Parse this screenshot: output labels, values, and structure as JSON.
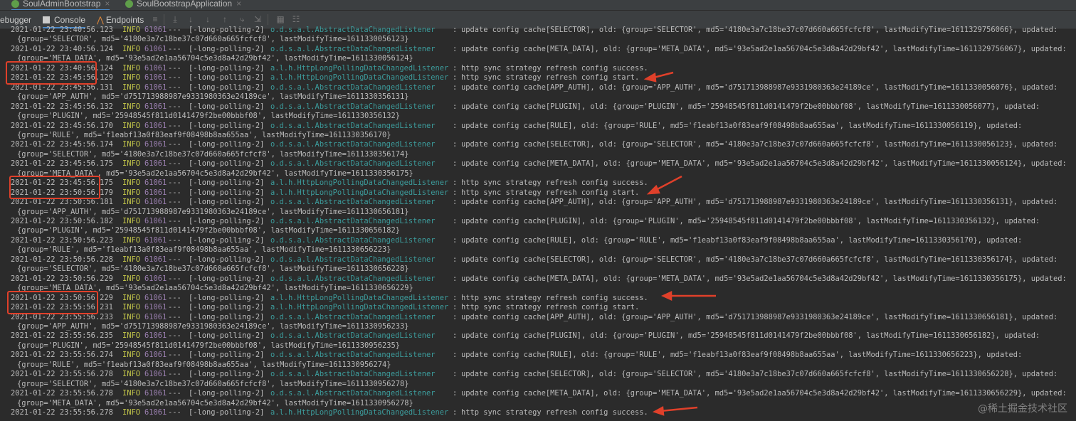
{
  "tabs": [
    {
      "label": "SoulAdminBootstrap",
      "active": true
    },
    {
      "label": "SoulBootstrapApplication",
      "active": false
    }
  ],
  "toolbar": {
    "debugger": "ebugger",
    "console": "Console",
    "endpoints": "Endpoints"
  },
  "watermark": "@稀土掘金技术社区",
  "colors": {
    "background": "#2b2b2b",
    "info": "#c5c84a",
    "pid": "#9b7fb0",
    "logger": "#3c9c9c",
    "highlight": "#e0402a"
  },
  "log": [
    {
      "time": "2021-01-22 23:40:56.123",
      "level": "INFO",
      "pid": "61061",
      "dash": "---",
      "thread": "[-long-polling-2]",
      "logger": "o.d.s.a.l.AbstractDataChangedListener",
      "msg": "update config cache[SELECTOR], old: {group='SELECTOR', md5='4180e3a7c18be37c07d660a665fcfcf8', lastModifyTime=1611329756066}, updated:"
    },
    {
      "cont": "{group='SELECTOR', md5='4180e3a7c18be37c07d660a665fcfcf8', lastModifyTime=1611330056123}"
    },
    {
      "time": "2021-01-22 23:40:56.124",
      "level": "INFO",
      "pid": "61061",
      "dash": "---",
      "thread": "[-long-polling-2]",
      "logger": "o.d.s.a.l.AbstractDataChangedListener",
      "msg": "update config cache[META_DATA], old: {group='META_DATA', md5='93e5ad2e1aa56704c5e3d8a42d29bf42', lastModifyTime=1611329756067}, updated:"
    },
    {
      "cont": "{group='META_DATA', md5='93e5ad2e1aa56704c5e3d8a42d29bf42', lastModifyTime=1611330056124}"
    },
    {
      "time": "2021-01-22 23:40:56.124",
      "level": "INFO",
      "pid": "61061",
      "dash": "---",
      "thread": "[-long-polling-2]",
      "logger": "a.l.h.HttpLongPollingDataChangedListener",
      "msg": "http sync strategy refresh config success."
    },
    {
      "time": "2021-01-22 23:45:56.129",
      "level": "INFO",
      "pid": "61061",
      "dash": "---",
      "thread": "[-long-polling-2]",
      "logger": "a.l.h.HttpLongPollingDataChangedListener",
      "msg": "http sync strategy refresh config start."
    },
    {
      "time": "2021-01-22 23:45:56.131",
      "level": "INFO",
      "pid": "61061",
      "dash": "---",
      "thread": "[-long-polling-2]",
      "logger": "o.d.s.a.l.AbstractDataChangedListener",
      "msg": "update config cache[APP_AUTH], old: {group='APP_AUTH', md5='d751713988987e9331980363e24189ce', lastModifyTime=1611330056076}, updated:"
    },
    {
      "cont": "{group='APP_AUTH', md5='d751713988987e9331980363e24189ce', lastModifyTime=1611330356131}"
    },
    {
      "time": "2021-01-22 23:45:56.132",
      "level": "INFO",
      "pid": "61061",
      "dash": "---",
      "thread": "[-long-polling-2]",
      "logger": "o.d.s.a.l.AbstractDataChangedListener",
      "msg": "update config cache[PLUGIN], old: {group='PLUGIN', md5='25948545f811d0141479f2be00bbbf08', lastModifyTime=1611330056077}, updated:"
    },
    {
      "cont": "{group='PLUGIN', md5='25948545f811d0141479f2be00bbbf08', lastModifyTime=1611330356132}"
    },
    {
      "time": "2021-01-22 23:45:56.170",
      "level": "INFO",
      "pid": "61061",
      "dash": "---",
      "thread": "[-long-polling-2]",
      "logger": "o.d.s.a.l.AbstractDataChangedListener",
      "msg": "update config cache[RULE], old: {group='RULE', md5='f1eabf13a0f83eaf9f08498b8aa655aa', lastModifyTime=1611330056119}, updated:"
    },
    {
      "cont": "{group='RULE', md5='f1eabf13a0f83eaf9f08498b8aa655aa', lastModifyTime=1611330356170}"
    },
    {
      "time": "2021-01-22 23:45:56.174",
      "level": "INFO",
      "pid": "61061",
      "dash": "---",
      "thread": "[-long-polling-2]",
      "logger": "o.d.s.a.l.AbstractDataChangedListener",
      "msg": "update config cache[SELECTOR], old: {group='SELECTOR', md5='4180e3a7c18be37c07d660a665fcfcf8', lastModifyTime=1611330056123}, updated:"
    },
    {
      "cont": "{group='SELECTOR', md5='4180e3a7c18be37c07d660a665fcfcf8', lastModifyTime=1611330356174}"
    },
    {
      "time": "2021-01-22 23:45:56.175",
      "level": "INFO",
      "pid": "61061",
      "dash": "---",
      "thread": "[-long-polling-2]",
      "logger": "o.d.s.a.l.AbstractDataChangedListener",
      "msg": "update config cache[META_DATA], old: {group='META_DATA', md5='93e5ad2e1aa56704c5e3d8a42d29bf42', lastModifyTime=1611330056124}, updated:"
    },
    {
      "cont": "{group='META_DATA', md5='93e5ad2e1aa56704c5e3d8a42d29bf42', lastModifyTime=1611330356175}"
    },
    {
      "time": "2021-01-22 23:45:56.175",
      "level": "INFO",
      "pid": "61061",
      "dash": "---",
      "thread": "[-long-polling-2]",
      "logger": "a.l.h.HttpLongPollingDataChangedListener",
      "msg": "http sync strategy refresh config success."
    },
    {
      "time": "2021-01-22 23:50:56.179",
      "level": "INFO",
      "pid": "61061",
      "dash": "---",
      "thread": "[-long-polling-2]",
      "logger": "a.l.h.HttpLongPollingDataChangedListener",
      "msg": "http sync strategy refresh config start."
    },
    {
      "time": "2021-01-22 23:50:56.181",
      "level": "INFO",
      "pid": "61061",
      "dash": "---",
      "thread": "[-long-polling-2]",
      "logger": "o.d.s.a.l.AbstractDataChangedListener",
      "msg": "update config cache[APP_AUTH], old: {group='APP_AUTH', md5='d751713988987e9331980363e24189ce', lastModifyTime=1611330356131}, updated:"
    },
    {
      "cont": "{group='APP_AUTH', md5='d751713988987e9331980363e24189ce', lastModifyTime=1611330656181}"
    },
    {
      "time": "2021-01-22 23:50:56.182",
      "level": "INFO",
      "pid": "61061",
      "dash": "---",
      "thread": "[-long-polling-2]",
      "logger": "o.d.s.a.l.AbstractDataChangedListener",
      "msg": "update config cache[PLUGIN], old: {group='PLUGIN', md5='25948545f811d0141479f2be00bbbf08', lastModifyTime=1611330356132}, updated:"
    },
    {
      "cont": "{group='PLUGIN', md5='25948545f811d0141479f2be00bbbf08', lastModifyTime=1611330656182}"
    },
    {
      "time": "2021-01-22 23:50:56.223",
      "level": "INFO",
      "pid": "61061",
      "dash": "---",
      "thread": "[-long-polling-2]",
      "logger": "o.d.s.a.l.AbstractDataChangedListener",
      "msg": "update config cache[RULE], old: {group='RULE', md5='f1eabf13a0f83eaf9f08498b8aa655aa', lastModifyTime=1611330356170}, updated:"
    },
    {
      "cont": "{group='RULE', md5='f1eabf13a0f83eaf9f08498b8aa655aa', lastModifyTime=1611330656223}"
    },
    {
      "time": "2021-01-22 23:50:56.228",
      "level": "INFO",
      "pid": "61061",
      "dash": "---",
      "thread": "[-long-polling-2]",
      "logger": "o.d.s.a.l.AbstractDataChangedListener",
      "msg": "update config cache[SELECTOR], old: {group='SELECTOR', md5='4180e3a7c18be37c07d660a665fcfcf8', lastModifyTime=1611330356174}, updated:"
    },
    {
      "cont": "{group='SELECTOR', md5='4180e3a7c18be37c07d660a665fcfcf8', lastModifyTime=1611330656228}"
    },
    {
      "time": "2021-01-22 23:50:56.229",
      "level": "INFO",
      "pid": "61061",
      "dash": "---",
      "thread": "[-long-polling-2]",
      "logger": "o.d.s.a.l.AbstractDataChangedListener",
      "msg": "update config cache[META_DATA], old: {group='META_DATA', md5='93e5ad2e1aa56704c5e3d8a42d29bf42', lastModifyTime=1611330356175}, updated:"
    },
    {
      "cont": "{group='META_DATA', md5='93e5ad2e1aa56704c5e3d8a42d29bf42', lastModifyTime=1611330656229}"
    },
    {
      "time": "2021-01-22 23:50:56.229",
      "level": "INFO",
      "pid": "61061",
      "dash": "---",
      "thread": "[-long-polling-2]",
      "logger": "a.l.h.HttpLongPollingDataChangedListener",
      "msg": "http sync strategy refresh config success."
    },
    {
      "time": "2021-01-22 23:55:56.231",
      "level": "INFO",
      "pid": "61061",
      "dash": "---",
      "thread": "[-long-polling-2]",
      "logger": "a.l.h.HttpLongPollingDataChangedListener",
      "msg": "http sync strategy refresh config start."
    },
    {
      "time": "2021-01-22 23:55:56.233",
      "level": "INFO",
      "pid": "61061",
      "dash": "---",
      "thread": "[-long-polling-2]",
      "logger": "o.d.s.a.l.AbstractDataChangedListener",
      "msg": "update config cache[APP_AUTH], old: {group='APP_AUTH', md5='d751713988987e9331980363e24189ce', lastModifyTime=1611330656181}, updated:"
    },
    {
      "cont": "{group='APP_AUTH', md5='d751713988987e9331980363e24189ce', lastModifyTime=1611330956233}"
    },
    {
      "time": "2021-01-22 23:55:56.235",
      "level": "INFO",
      "pid": "61061",
      "dash": "---",
      "thread": "[-long-polling-2]",
      "logger": "o.d.s.a.l.AbstractDataChangedListener",
      "msg": "update config cache[PLUGIN], old: {group='PLUGIN', md5='25948545f811d0141479f2be00bbbf08', lastModifyTime=1611330656182}, updated:"
    },
    {
      "cont": "{group='PLUGIN', md5='25948545f811d0141479f2be00bbbf08', lastModifyTime=1611330956235}"
    },
    {
      "time": "2021-01-22 23:55:56.274",
      "level": "INFO",
      "pid": "61061",
      "dash": "---",
      "thread": "[-long-polling-2]",
      "logger": "o.d.s.a.l.AbstractDataChangedListener",
      "msg": "update config cache[RULE], old: {group='RULE', md5='f1eabf13a0f83eaf9f08498b8aa655aa', lastModifyTime=1611330656223}, updated:"
    },
    {
      "cont": "{group='RULE', md5='f1eabf13a0f83eaf9f08498b8aa655aa', lastModifyTime=1611330956274}"
    },
    {
      "time": "2021-01-22 23:55:56.278",
      "level": "INFO",
      "pid": "61061",
      "dash": "---",
      "thread": "[-long-polling-2]",
      "logger": "o.d.s.a.l.AbstractDataChangedListener",
      "msg": "update config cache[SELECTOR], old: {group='SELECTOR', md5='4180e3a7c18be37c07d660a665fcfcf8', lastModifyTime=1611330656228}, updated:"
    },
    {
      "cont": "{group='SELECTOR', md5='4180e3a7c18be37c07d660a665fcfcf8', lastModifyTime=1611330956278}"
    },
    {
      "time": "2021-01-22 23:55:56.278",
      "level": "INFO",
      "pid": "61061",
      "dash": "---",
      "thread": "[-long-polling-2]",
      "logger": "o.d.s.a.l.AbstractDataChangedListener",
      "msg": "update config cache[META_DATA], old: {group='META_DATA', md5='93e5ad2e1aa56704c5e3d8a42d29bf42', lastModifyTime=1611330656229}, updated:"
    },
    {
      "cont": "{group='META_DATA', md5='93e5ad2e1aa56704c5e3d8a42d29bf42', lastModifyTime=1611330956278}"
    },
    {
      "time": "2021-01-22 23:55:56.278",
      "level": "INFO",
      "pid": "61061",
      "dash": "---",
      "thread": "[-long-polling-2]",
      "logger": "a.l.h.HttpLongPollingDataChangedListener",
      "msg": "http sync strategy refresh config success."
    }
  ]
}
